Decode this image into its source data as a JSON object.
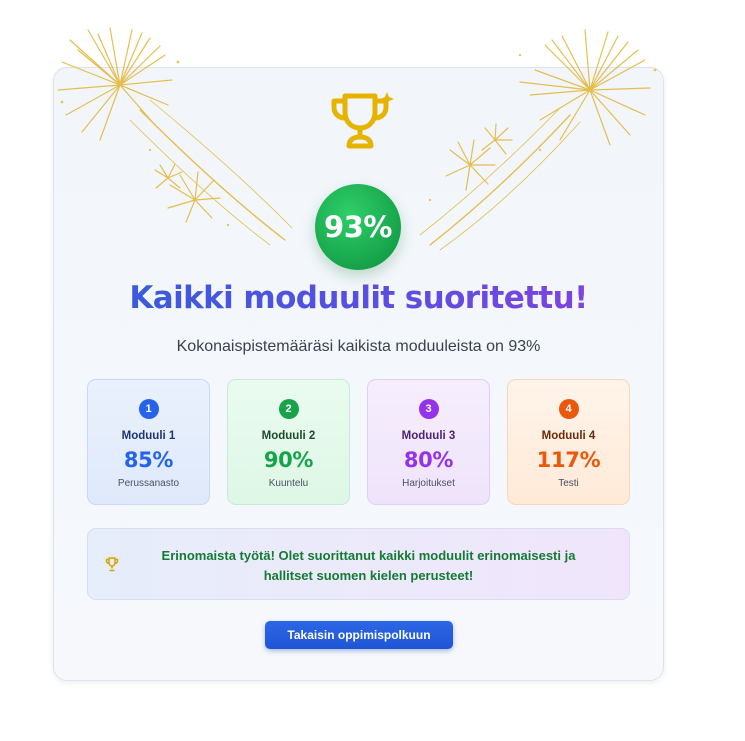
{
  "score": {
    "value_label": "93%",
    "value": 93,
    "color": "#16a34a"
  },
  "title": "Kaikki moduulit suoritettu!",
  "subtitle": "Kokonaispistemääräsi kaikista moduuleista on 93%",
  "icons": {
    "trophy": "trophy-icon",
    "message": "trophy-icon",
    "decoration": "fireworks"
  },
  "modules": [
    {
      "number": "1",
      "name": "Moduuli 1",
      "score": "85%",
      "description": "Perussanasto",
      "color": "#2563eb"
    },
    {
      "number": "2",
      "name": "Moduuli 2",
      "score": "90%",
      "description": "Kuuntelu",
      "color": "#16a34a"
    },
    {
      "number": "3",
      "name": "Moduuli 3",
      "score": "80%",
      "description": "Harjoitukset",
      "color": "#9333ea"
    },
    {
      "number": "4",
      "name": "Moduuli 4",
      "score": "117%",
      "description": "Testi",
      "color": "#ea580c"
    }
  ],
  "message": {
    "text": "Erinomaista työtä! Olet suorittanut kaikki moduulit erinomaisesti ja hallitset suomen kielen perusteet!"
  },
  "back_button": {
    "label": "Takaisin oppimispolkuun",
    "color": "#1f55d4"
  },
  "colors": {
    "accent_gold": "#e6b400",
    "title_gradient_start": "#2f5fdc",
    "title_gradient_end": "#8a3fe0"
  }
}
